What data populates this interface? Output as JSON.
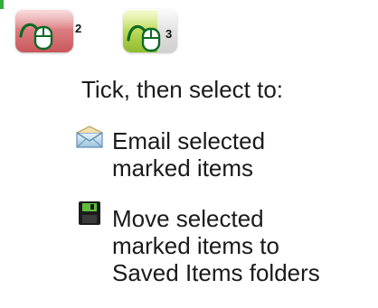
{
  "mouse_buttons": [
    {
      "icon": "mouse-click-icon",
      "number": "2",
      "color": "#dd7f83"
    },
    {
      "icon": "mouse-click-icon",
      "number": "3",
      "color": "#bfdc5c"
    }
  ],
  "instruction": "Tick, then select to:",
  "actions": [
    {
      "icon": "envelope-icon",
      "lines": [
        "Email selected",
        "marked items"
      ]
    },
    {
      "icon": "floppy-disk-icon",
      "lines": [
        "Move selected",
        "marked items to",
        "Saved Items folders"
      ]
    }
  ]
}
